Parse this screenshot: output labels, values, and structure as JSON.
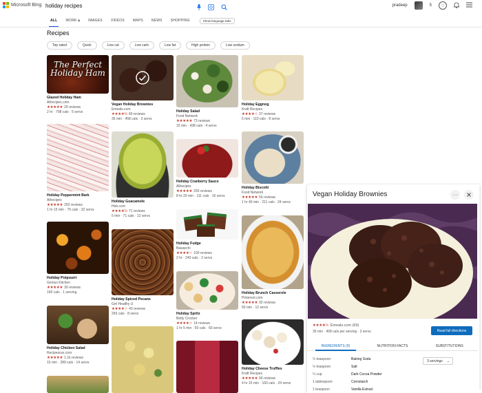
{
  "header": {
    "brand": "Microsoft Bing",
    "query": "holiday recipes",
    "user": "pradeep",
    "reward_count": "5",
    "tabs": [
      {
        "label": "ALL",
        "active": true
      },
      {
        "label": "WORK",
        "active": false
      },
      {
        "label": "IMAGES",
        "active": false
      },
      {
        "label": "VIDEOS",
        "active": false
      },
      {
        "label": "MAPS",
        "active": false
      },
      {
        "label": "NEWS",
        "active": false
      },
      {
        "label": "SHOPPING",
        "active": false
      }
    ],
    "language_btn": "Show language tabs"
  },
  "recipes": {
    "title": "Recipes",
    "filters": [
      "Top rated",
      "Quick",
      "Low cal",
      "Low carb",
      "Low fat",
      "High protein",
      "Low sodium"
    ],
    "cards": [
      {
        "title": "Glazed Holiday Ham",
        "source": "Allrecipes.com",
        "stars": "★★★★★",
        "reviews": "29 reviews",
        "meta": "2 hr · 798 cals · 5 servs"
      },
      {
        "title": "Vegan Holiday Brownies",
        "source": "Emeals.com",
        "stars": "★★★★½",
        "reviews": "69 reviews",
        "meta": "35 min · 458 cals · 3 servs"
      },
      {
        "title": "Holiday Salad",
        "source": "Food Network",
        "stars": "★★★★★",
        "reviews": "73 reviews",
        "meta": "15 min · 438 cals · 4 servs"
      },
      {
        "title": "Holiday Eggnog",
        "source": "Kraft Recipes",
        "stars": "★★★★☆",
        "reviews": "37 reviews",
        "meta": "5 min · 110 cals · 8 servs"
      },
      {
        "title": "Holiday Peppermint Bark",
        "source": "Allrecipes",
        "stars": "★★★★★",
        "reviews": "292 reviews",
        "meta": "1 hr 15 min · 75 cals · 32 servs"
      },
      {
        "title": "Holiday Guacamole",
        "source": "Heb.com",
        "stars": "★★★★½",
        "reviews": "71 reviews",
        "meta": "5 min · 71 cals · 12 servs"
      },
      {
        "title": "Holiday Cranberry Sauce",
        "source": "Allrecipes",
        "stars": "★★★★★",
        "reviews": "255 reviews",
        "meta": "8 hr 20 min · 111 cals · 16 servs"
      },
      {
        "title": "Holiday Biscotti",
        "source": "Food Network",
        "stars": "★★★★★",
        "reviews": "56 reviews",
        "meta": "1 hr 40 min · 211 cals · 24 servs"
      },
      {
        "title": "Holiday Potpourri",
        "source": "Genius Kitchen",
        "stars": "★★★★★",
        "reviews": "30 reviews",
        "meta": "169 cals · 1 serving"
      },
      {
        "title": "Holiday Spiced Pecans",
        "source": "Get Healthy U",
        "stars": "★★★★☆",
        "reviews": "43 reviews",
        "meta": "293 cals · 8 servs"
      },
      {
        "title": "Holiday Fudge",
        "source": "Bawarchi",
        "stars": "★★★★☆",
        "reviews": "100 reviews",
        "meta": "2 hr · 240 cals · 2 servs"
      },
      {
        "title": "Holiday Brunch Casserole",
        "source": "Pinterest.com",
        "stars": "★★★★★",
        "reviews": "92 reviews",
        "meta": "50 min · 12 servs"
      },
      {
        "title": "Holiday Chicken Salad",
        "source": "Recipesrun.com",
        "stars": "★★★★★",
        "reviews": "1.1k reviews",
        "meta": "15 min · 289 cals · 14 servs"
      },
      {
        "title": "Holiday Spritz",
        "source": "Betty Crocker",
        "stars": "★★★★☆",
        "reviews": "14 reviews",
        "meta": "1 hr 5 min · 50 cals · 60 servs"
      },
      {
        "title": "Holiday Cheese Truffles",
        "source": "Kraft Recipes",
        "stars": "★★★★★",
        "reviews": "66 reviews",
        "meta": "4 hr 15 min · 160 cals · 24 servs"
      }
    ]
  },
  "panel": {
    "title": "Vegan Holiday Brownies",
    "stars": "★★★★½",
    "source_reviews": "Emeals.com (69)",
    "meta": "35 min · 458 cals per serving · 3 servs",
    "read_button": "Read full directions",
    "tabs": [
      "INGREDIENTS (9)",
      "NUTRITION FACTS",
      "SUBSTITUTIONS"
    ],
    "servings": "3 servings",
    "ingredients": [
      {
        "amount": "½ teaspoon",
        "name": "Baking Soda"
      },
      {
        "amount": "½ teaspoon",
        "name": "Salt"
      },
      {
        "amount": "¼ cup",
        "name": "Dark Cocoa Powder"
      },
      {
        "amount": "1 tablespoon",
        "name": "Cornstarch"
      },
      {
        "amount": "1 teaspoon",
        "name": "Vanilla Extract"
      }
    ]
  },
  "colors": {
    "accent": "#174ae4",
    "star": "#c0392b",
    "button": "#0f6cbd"
  }
}
